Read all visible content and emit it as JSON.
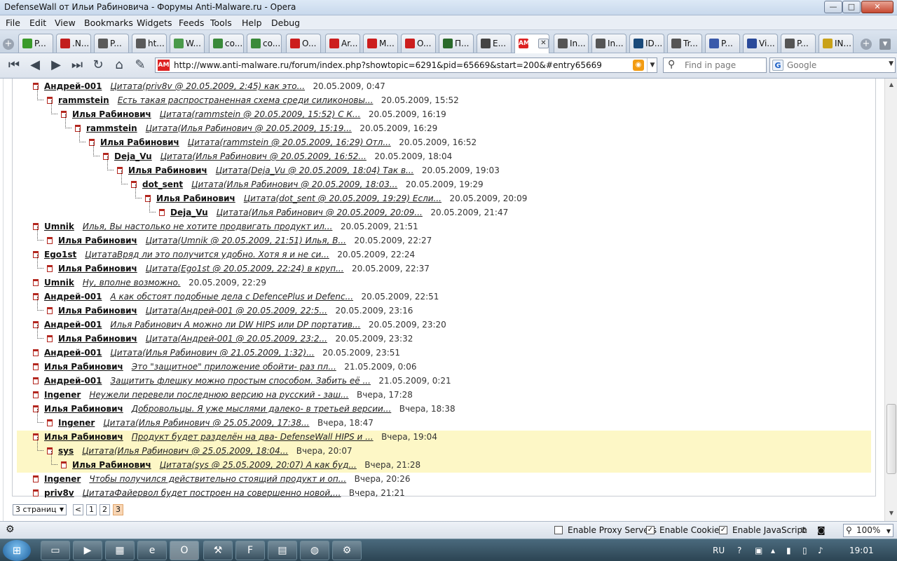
{
  "window": {
    "title": "DefenseWall от Ильи Рабиновича - Форумы Anti-Malware.ru - Opera",
    "min_glyph": "—",
    "max_glyph": "□",
    "close_glyph": "✕"
  },
  "menu": [
    "File",
    "Edit",
    "View",
    "Bookmarks",
    "Widgets",
    "Feeds",
    "Tools",
    "Help",
    "Debug"
  ],
  "tabs": [
    {
      "label": "P...",
      "color": "#3a9a2a"
    },
    {
      "label": ".N...",
      "color": "#c21d1d"
    },
    {
      "label": "P...",
      "color": "#5a5a5a"
    },
    {
      "label": "ht...",
      "color": "#5a5a5a"
    },
    {
      "label": "W...",
      "color": "#4a9a4a"
    },
    {
      "label": "co...",
      "color": "#3a8a3a"
    },
    {
      "label": "co...",
      "color": "#3a8a3a"
    },
    {
      "label": "O...",
      "color": "#cc1e1e"
    },
    {
      "label": "Ar...",
      "color": "#cc1e1e"
    },
    {
      "label": "M...",
      "color": "#cc1e1e"
    },
    {
      "label": "O...",
      "color": "#cc1e1e"
    },
    {
      "label": "П...",
      "color": "#2a6a2a"
    },
    {
      "label": "E...",
      "color": "#444"
    },
    {
      "label": "",
      "color": "#d22"
    },
    {
      "label": "In...",
      "color": "#555"
    },
    {
      "label": "In...",
      "color": "#555"
    },
    {
      "label": "ID...",
      "color": "#1a4a7a"
    },
    {
      "label": "Tr...",
      "color": "#555"
    },
    {
      "label": "P...",
      "color": "#3a5aaa"
    },
    {
      "label": "Vi...",
      "color": "#2a4a9a"
    },
    {
      "label": "P...",
      "color": "#555"
    },
    {
      "label": "IN...",
      "color": "#c9a21a"
    }
  ],
  "address": {
    "url": "http://www.anti-malware.ru/forum/index.php?showtopic=6291&pid=65669&start=200&#entry65669",
    "find_placeholder": "Find in page",
    "search_engine": "Google"
  },
  "posts": [
    {
      "author": "Андрей-001",
      "snippet": "Цитата(priv8v @ 20.05.2009, 2:45) как это...",
      "date": "20.05.2009, 0:47",
      "level": 0
    },
    {
      "author": "rammstein",
      "snippet": "Есть такая распространенная схема среди силиконовы...",
      "date": "20.05.2009, 15:52",
      "level": 1
    },
    {
      "author": "Илья Рабинович",
      "snippet": "Цитата(rammstein @ 20.05.2009, 15:52) С К...",
      "date": "20.05.2009, 16:19",
      "level": 2
    },
    {
      "author": "rammstein",
      "snippet": "Цитата(Илья Рабинович @ 20.05.2009, 15:19...",
      "date": "20.05.2009, 16:29",
      "level": 3
    },
    {
      "author": "Илья Рабинович",
      "snippet": "Цитата(rammstein @ 20.05.2009, 16:29) Отл...",
      "date": "20.05.2009, 16:52",
      "level": 4
    },
    {
      "author": "Deja_Vu",
      "snippet": "Цитата(Илья Рабинович @ 20.05.2009, 16:52...",
      "date": "20.05.2009, 18:04",
      "level": 5
    },
    {
      "author": "Илья Рабинович",
      "snippet": "Цитата(Deja_Vu @ 20.05.2009, 18:04) Так в...",
      "date": "20.05.2009, 19:03",
      "level": 6
    },
    {
      "author": "dot_sent",
      "snippet": "Цитата(Илья Рабинович @ 20.05.2009, 18:03...",
      "date": "20.05.2009, 19:29",
      "level": 7
    },
    {
      "author": "Илья Рабинович",
      "snippet": "Цитата(dot_sent @ 20.05.2009, 19:29) Если...",
      "date": "20.05.2009, 20:09",
      "level": 8
    },
    {
      "author": "Deja_Vu",
      "snippet": "Цитата(Илья Рабинович @ 20.05.2009, 20:09...",
      "date": "20.05.2009, 21:47",
      "level": 9
    },
    {
      "author": "Umnik",
      "snippet": "Илья, Вы настолько не хотите продвигать продукт ил...",
      "date": "20.05.2009, 21:51",
      "level": 0
    },
    {
      "author": "Илья Рабинович",
      "snippet": "Цитата(Umnik @ 20.05.2009, 21:51) Илья, В...",
      "date": "20.05.2009, 22:27",
      "level": 1
    },
    {
      "author": "Ego1st",
      "snippet": "ЦитатаВряд ли это получится удобно. Хотя я и не си...",
      "date": "20.05.2009, 22:24",
      "level": 0
    },
    {
      "author": "Илья Рабинович",
      "snippet": "Цитата(Ego1st @ 20.05.2009, 22:24) в круп...",
      "date": "20.05.2009, 22:37",
      "level": 1
    },
    {
      "author": "Umnik",
      "snippet": "Ну, вполне возможно.",
      "date": "20.05.2009, 22:29",
      "level": 0
    },
    {
      "author": "Андрей-001",
      "snippet": "А как обстоят подобные дела с DefencePlus и Defenc...",
      "date": "20.05.2009, 22:51",
      "level": 0
    },
    {
      "author": "Илья Рабинович",
      "snippet": "Цитата(Андрей-001 @ 20.05.2009, 22:5...",
      "date": "20.05.2009, 23:16",
      "level": 1
    },
    {
      "author": "Андрей-001",
      "snippet": "Илья Рабинович А можно ли DW HIPS или DP портатив...",
      "date": "20.05.2009, 23:20",
      "level": 0
    },
    {
      "author": "Илья Рабинович",
      "snippet": "Цитата(Андрей-001 @ 20.05.2009, 23:2...",
      "date": "20.05.2009, 23:32",
      "level": 1
    },
    {
      "author": "Андрей-001",
      "snippet": "Цитата(Илья Рабинович @ 21.05.2009, 1:32)...",
      "date": "20.05.2009, 23:51",
      "level": 0
    },
    {
      "author": "Илья Рабинович",
      "snippet": "Это \"защитное\" приложение обойти- раз пл...",
      "date": "21.05.2009, 0:06",
      "level": 0
    },
    {
      "author": "Андрей-001",
      "snippet": "Защитить флешку можно простым способом. Забить её ...",
      "date": "21.05.2009, 0:21",
      "level": 0
    },
    {
      "author": "Ingener",
      "snippet": "Неужели перевели последнюю версию на русский - заш...",
      "date": "Вчера, 17:28",
      "level": 0
    },
    {
      "author": "Илья Рабинович",
      "snippet": "Добровольцы. Я уже мыслями далеко- в третьей версии...",
      "date": "Вчера, 18:38",
      "level": 0
    },
    {
      "author": "Ingener",
      "snippet": "Цитата(Илья Рабинович @ 25.05.2009, 17:38...",
      "date": "Вчера, 18:47",
      "level": 1
    },
    {
      "author": "Илья Рабинович",
      "snippet": "Продукт будет разделён на два- DefenseWall HIPS и ...",
      "date": "Вчера, 19:04",
      "level": 0
    },
    {
      "author": "sys",
      "snippet": "Цитата(Илья Рабинович @ 25.05.2009, 18:04...",
      "date": "Вчера, 20:07",
      "level": 1
    },
    {
      "author": "Илья Рабинович",
      "snippet": "Цитата(sys @ 25.05.2009, 20:07) А как буд...",
      "date": "Вчера, 21:28",
      "level": 2
    },
    {
      "author": "Ingener",
      "snippet": "Чтобы получился действительно стоящий продукт и оп...",
      "date": "Вчера, 20:26",
      "level": 0
    },
    {
      "author": "priv8v",
      "snippet": "ЦитатаФайервол будет построен на совершенно новой,...",
      "date": "Вчера, 21:21",
      "level": 0
    }
  ],
  "pager": {
    "label": "3 страниц",
    "prev": "<",
    "pages": [
      "1",
      "2",
      "3"
    ],
    "current": "3"
  },
  "status": {
    "proxy_label": "Enable Proxy Servers",
    "proxy_checked": false,
    "cookies_label": "Enable Cookies",
    "cookies_checked": true,
    "js_label": "Enable JavaScript",
    "js_checked": true,
    "zoom": "100%"
  },
  "taskbar": {
    "lang": "RU",
    "clock": "19:01"
  },
  "colors": {
    "highlight": "#fdf7c6",
    "post_icon": "#b3261e",
    "current_page": "#f8d6b5"
  }
}
